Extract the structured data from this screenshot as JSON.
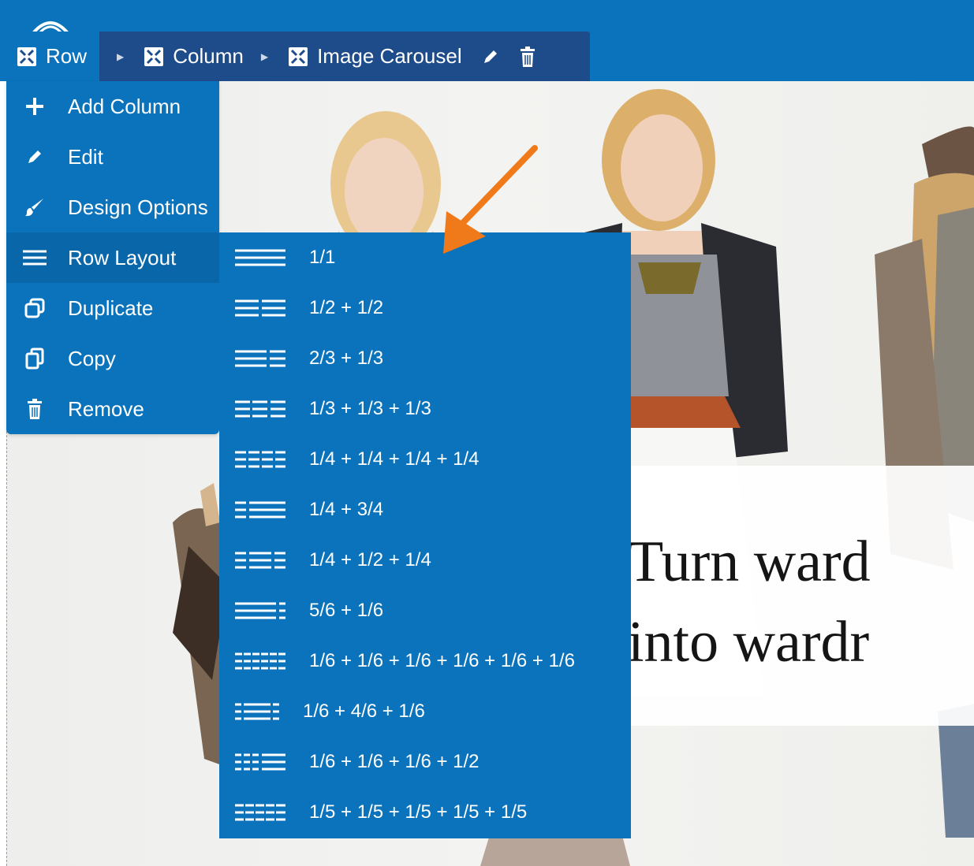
{
  "breadcrumb": {
    "items": [
      {
        "label": "Row",
        "icon": "move-arrows-icon"
      },
      {
        "label": "Column",
        "icon": "move-arrows-icon"
      },
      {
        "label": "Image Carousel",
        "icon": "move-arrows-icon"
      }
    ],
    "separator_icon": "caret-right-icon",
    "actions": [
      "pencil-icon",
      "trash-icon"
    ]
  },
  "row_menu": {
    "items": [
      {
        "label": "Add Column",
        "icon": "plus-icon"
      },
      {
        "label": "Edit",
        "icon": "pencil-icon"
      },
      {
        "label": "Design Options",
        "icon": "brush-icon"
      },
      {
        "label": "Row Layout",
        "icon": "lines-icon",
        "active": true
      },
      {
        "label": "Duplicate",
        "icon": "duplicate-icon"
      },
      {
        "label": "Copy",
        "icon": "copy-icon"
      },
      {
        "label": "Remove",
        "icon": "trash-icon"
      }
    ]
  },
  "row_layout_menu": {
    "options": [
      {
        "label": "1/1"
      },
      {
        "label": "1/2 + 1/2"
      },
      {
        "label": "2/3 + 1/3"
      },
      {
        "label": "1/3 + 1/3 + 1/3"
      },
      {
        "label": "1/4 + 1/4 + 1/4 + 1/4"
      },
      {
        "label": "1/4 + 3/4"
      },
      {
        "label": "1/4 + 1/2 + 1/4"
      },
      {
        "label": "5/6 + 1/6"
      },
      {
        "label": "1/6 + 1/6 + 1/6 + 1/6 + 1/6 + 1/6"
      },
      {
        "label": "1/6 + 4/6 + 1/6"
      },
      {
        "label": "1/6 + 1/6 + 1/6 + 1/2"
      },
      {
        "label": "1/5 + 1/5 + 1/5 + 1/5 + 1/5"
      }
    ]
  },
  "hero": {
    "line1": "Turn ward",
    "line2": "into wardr"
  },
  "colors": {
    "menu_blue": "#0a73bb",
    "breadcrumb_navy": "#1e4b8a",
    "active_item": "#0966a8",
    "annotation_arrow": "#f07a1a"
  }
}
